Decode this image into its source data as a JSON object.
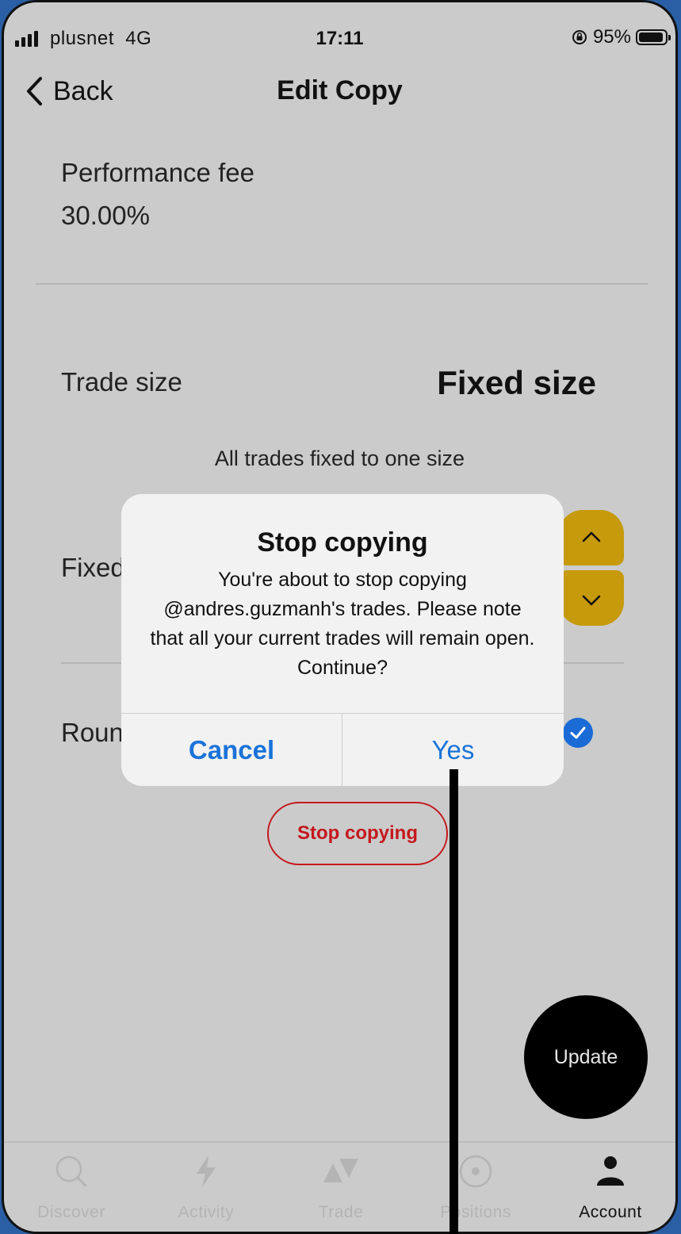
{
  "status_bar": {
    "carrier": "plusnet",
    "network": "4G",
    "time": "17:11",
    "battery_percent": "95%"
  },
  "nav": {
    "back_label": "Back",
    "title": "Edit Copy"
  },
  "performance_fee": {
    "label": "Performance fee",
    "value": "30.00%"
  },
  "trade_size": {
    "label": "Trade size",
    "value": "Fixed size",
    "description": "All trades fixed to one size"
  },
  "fixed_row": {
    "label_partial": "Fixed"
  },
  "round_row": {
    "label_partial": "Roun",
    "checked": true
  },
  "stop_copying_button": "Stop copying",
  "update_button": "Update",
  "dialog": {
    "title": "Stop copying",
    "message": "You're about to stop copying @andres.guzmanh's trades. Please note that all your current trades will remain open. Continue?",
    "cancel_label": "Cancel",
    "yes_label": "Yes"
  },
  "tabs": [
    {
      "label": "Discover",
      "icon": "search-icon",
      "active": false
    },
    {
      "label": "Activity",
      "icon": "lightning-icon",
      "active": false
    },
    {
      "label": "Trade",
      "icon": "trade-icon",
      "active": false
    },
    {
      "label": "Positions",
      "icon": "positions-icon",
      "active": false
    },
    {
      "label": "Account",
      "icon": "person-icon",
      "active": true
    }
  ],
  "colors": {
    "accent_blue": "#1a73d9",
    "stop_red": "#c4181c",
    "stepper_gold": "#c69a0a"
  }
}
